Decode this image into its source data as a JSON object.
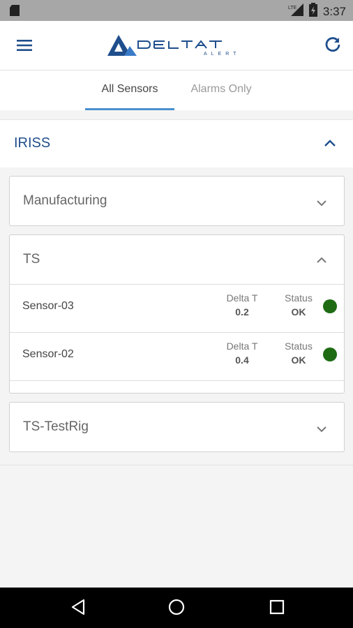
{
  "status_bar": {
    "time": "3:37",
    "icons": [
      "sd-card-icon",
      "signal-icon",
      "battery-charging-icon"
    ]
  },
  "app_bar": {
    "logo_text": "DELTA T ALERT",
    "menu_icon": "hamburger-menu-icon",
    "refresh_icon": "refresh-icon",
    "brand_color": "#1f4e8c"
  },
  "tabs": [
    {
      "label": "All Sensors",
      "active": true
    },
    {
      "label": "Alarms Only",
      "active": false
    }
  ],
  "group": {
    "title": "IRISS",
    "expanded": true,
    "subgroups": [
      {
        "title": "Manufacturing",
        "expanded": false,
        "sensors": []
      },
      {
        "title": "TS",
        "expanded": true,
        "sensors": [
          {
            "name": "Sensor-03",
            "delta_label": "Delta T",
            "delta_value": "0.2",
            "status_label": "Status",
            "status_value": "OK",
            "status_color": "#1e6b14"
          },
          {
            "name": "Sensor-02",
            "delta_label": "Delta T",
            "delta_value": "0.4",
            "status_label": "Status",
            "status_value": "OK",
            "status_color": "#1e6b14"
          }
        ]
      },
      {
        "title": "TS-TestRig",
        "expanded": false,
        "sensors": []
      }
    ]
  },
  "nav_bar": {
    "buttons": [
      "back-icon",
      "home-icon",
      "recents-icon"
    ]
  }
}
